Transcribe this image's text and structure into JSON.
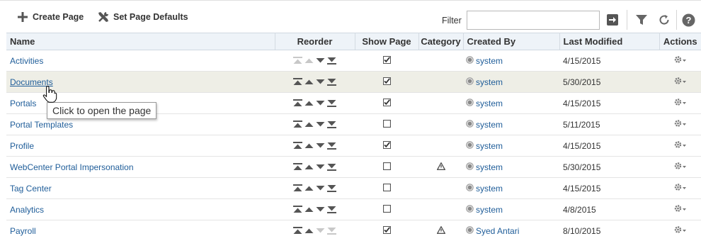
{
  "toolbar": {
    "create_page_label": "Create Page",
    "set_defaults_label": "Set Page Defaults",
    "filter_label": "Filter",
    "filter_value": ""
  },
  "columns": {
    "name": "Name",
    "reorder": "Reorder",
    "show_page": "Show Page",
    "category": "Category",
    "created_by": "Created By",
    "last_modified": "Last Modified",
    "actions": "Actions"
  },
  "rows": [
    {
      "name": "Activities",
      "shown": true,
      "category": false,
      "created_by": "system",
      "modified": "4/15/2015",
      "top": false,
      "bottom": true
    },
    {
      "name": "Documents",
      "shown": true,
      "category": false,
      "created_by": "system",
      "modified": "5/30/2015",
      "top": true,
      "bottom": true
    },
    {
      "name": "Portals",
      "shown": true,
      "category": false,
      "created_by": "system",
      "modified": "4/15/2015",
      "top": true,
      "bottom": true
    },
    {
      "name": "Portal Templates",
      "shown": false,
      "category": false,
      "created_by": "system",
      "modified": "5/11/2015",
      "top": true,
      "bottom": true
    },
    {
      "name": "Profile",
      "shown": true,
      "category": false,
      "created_by": "system",
      "modified": "4/15/2015",
      "top": true,
      "bottom": true
    },
    {
      "name": "WebCenter Portal Impersonation",
      "shown": false,
      "category": true,
      "created_by": "system",
      "modified": "5/30/2015",
      "top": true,
      "bottom": true
    },
    {
      "name": "Tag Center",
      "shown": false,
      "category": false,
      "created_by": "system",
      "modified": "4/15/2015",
      "top": true,
      "bottom": true
    },
    {
      "name": "Analytics",
      "shown": false,
      "category": false,
      "created_by": "system",
      "modified": "4/8/2015",
      "top": true,
      "bottom": true
    },
    {
      "name": "Payroll",
      "shown": true,
      "category": true,
      "created_by": "Syed Antari",
      "modified": "8/10/2015",
      "top": true,
      "bottom": false
    }
  ],
  "tooltip": {
    "text": "Click to open the page"
  },
  "colors": {
    "link": "#1f5d99",
    "header_bg": "#eef3f8",
    "hover_row": "#eeeee6",
    "arrow_active": "#555555",
    "arrow_disabled": "#c8c8c8"
  }
}
